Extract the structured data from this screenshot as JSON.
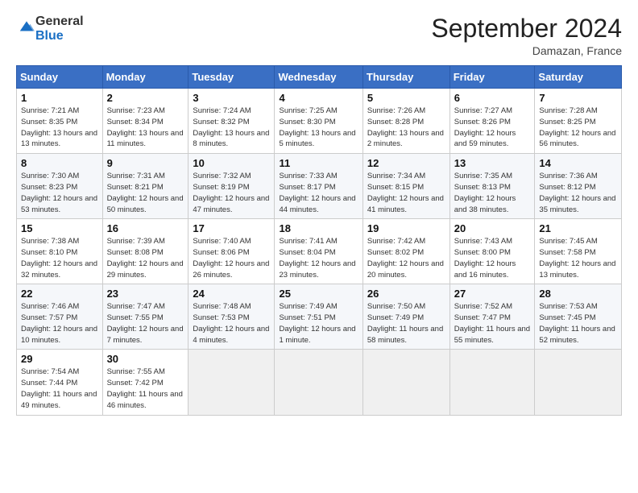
{
  "header": {
    "logo_general": "General",
    "logo_blue": "Blue",
    "title": "September 2024",
    "location": "Damazan, France"
  },
  "calendar": {
    "days_of_week": [
      "Sunday",
      "Monday",
      "Tuesday",
      "Wednesday",
      "Thursday",
      "Friday",
      "Saturday"
    ],
    "weeks": [
      [
        {
          "day": "1",
          "sunrise": "7:21 AM",
          "sunset": "8:35 PM",
          "daylight": "13 hours and 13 minutes."
        },
        {
          "day": "2",
          "sunrise": "7:23 AM",
          "sunset": "8:34 PM",
          "daylight": "13 hours and 11 minutes."
        },
        {
          "day": "3",
          "sunrise": "7:24 AM",
          "sunset": "8:32 PM",
          "daylight": "13 hours and 8 minutes."
        },
        {
          "day": "4",
          "sunrise": "7:25 AM",
          "sunset": "8:30 PM",
          "daylight": "13 hours and 5 minutes."
        },
        {
          "day": "5",
          "sunrise": "7:26 AM",
          "sunset": "8:28 PM",
          "daylight": "13 hours and 2 minutes."
        },
        {
          "day": "6",
          "sunrise": "7:27 AM",
          "sunset": "8:26 PM",
          "daylight": "12 hours and 59 minutes."
        },
        {
          "day": "7",
          "sunrise": "7:28 AM",
          "sunset": "8:25 PM",
          "daylight": "12 hours and 56 minutes."
        }
      ],
      [
        {
          "day": "8",
          "sunrise": "7:30 AM",
          "sunset": "8:23 PM",
          "daylight": "12 hours and 53 minutes."
        },
        {
          "day": "9",
          "sunrise": "7:31 AM",
          "sunset": "8:21 PM",
          "daylight": "12 hours and 50 minutes."
        },
        {
          "day": "10",
          "sunrise": "7:32 AM",
          "sunset": "8:19 PM",
          "daylight": "12 hours and 47 minutes."
        },
        {
          "day": "11",
          "sunrise": "7:33 AM",
          "sunset": "8:17 PM",
          "daylight": "12 hours and 44 minutes."
        },
        {
          "day": "12",
          "sunrise": "7:34 AM",
          "sunset": "8:15 PM",
          "daylight": "12 hours and 41 minutes."
        },
        {
          "day": "13",
          "sunrise": "7:35 AM",
          "sunset": "8:13 PM",
          "daylight": "12 hours and 38 minutes."
        },
        {
          "day": "14",
          "sunrise": "7:36 AM",
          "sunset": "8:12 PM",
          "daylight": "12 hours and 35 minutes."
        }
      ],
      [
        {
          "day": "15",
          "sunrise": "7:38 AM",
          "sunset": "8:10 PM",
          "daylight": "12 hours and 32 minutes."
        },
        {
          "day": "16",
          "sunrise": "7:39 AM",
          "sunset": "8:08 PM",
          "daylight": "12 hours and 29 minutes."
        },
        {
          "day": "17",
          "sunrise": "7:40 AM",
          "sunset": "8:06 PM",
          "daylight": "12 hours and 26 minutes."
        },
        {
          "day": "18",
          "sunrise": "7:41 AM",
          "sunset": "8:04 PM",
          "daylight": "12 hours and 23 minutes."
        },
        {
          "day": "19",
          "sunrise": "7:42 AM",
          "sunset": "8:02 PM",
          "daylight": "12 hours and 20 minutes."
        },
        {
          "day": "20",
          "sunrise": "7:43 AM",
          "sunset": "8:00 PM",
          "daylight": "12 hours and 16 minutes."
        },
        {
          "day": "21",
          "sunrise": "7:45 AM",
          "sunset": "7:58 PM",
          "daylight": "12 hours and 13 minutes."
        }
      ],
      [
        {
          "day": "22",
          "sunrise": "7:46 AM",
          "sunset": "7:57 PM",
          "daylight": "12 hours and 10 minutes."
        },
        {
          "day": "23",
          "sunrise": "7:47 AM",
          "sunset": "7:55 PM",
          "daylight": "12 hours and 7 minutes."
        },
        {
          "day": "24",
          "sunrise": "7:48 AM",
          "sunset": "7:53 PM",
          "daylight": "12 hours and 4 minutes."
        },
        {
          "day": "25",
          "sunrise": "7:49 AM",
          "sunset": "7:51 PM",
          "daylight": "12 hours and 1 minute."
        },
        {
          "day": "26",
          "sunrise": "7:50 AM",
          "sunset": "7:49 PM",
          "daylight": "11 hours and 58 minutes."
        },
        {
          "day": "27",
          "sunrise": "7:52 AM",
          "sunset": "7:47 PM",
          "daylight": "11 hours and 55 minutes."
        },
        {
          "day": "28",
          "sunrise": "7:53 AM",
          "sunset": "7:45 PM",
          "daylight": "11 hours and 52 minutes."
        }
      ],
      [
        {
          "day": "29",
          "sunrise": "7:54 AM",
          "sunset": "7:44 PM",
          "daylight": "11 hours and 49 minutes."
        },
        {
          "day": "30",
          "sunrise": "7:55 AM",
          "sunset": "7:42 PM",
          "daylight": "11 hours and 46 minutes."
        },
        {
          "day": "",
          "sunrise": "",
          "sunset": "",
          "daylight": ""
        },
        {
          "day": "",
          "sunrise": "",
          "sunset": "",
          "daylight": ""
        },
        {
          "day": "",
          "sunrise": "",
          "sunset": "",
          "daylight": ""
        },
        {
          "day": "",
          "sunrise": "",
          "sunset": "",
          "daylight": ""
        },
        {
          "day": "",
          "sunrise": "",
          "sunset": "",
          "daylight": ""
        }
      ]
    ],
    "labels": {
      "sunrise": "Sunrise:",
      "sunset": "Sunset:",
      "daylight": "Daylight:"
    }
  }
}
